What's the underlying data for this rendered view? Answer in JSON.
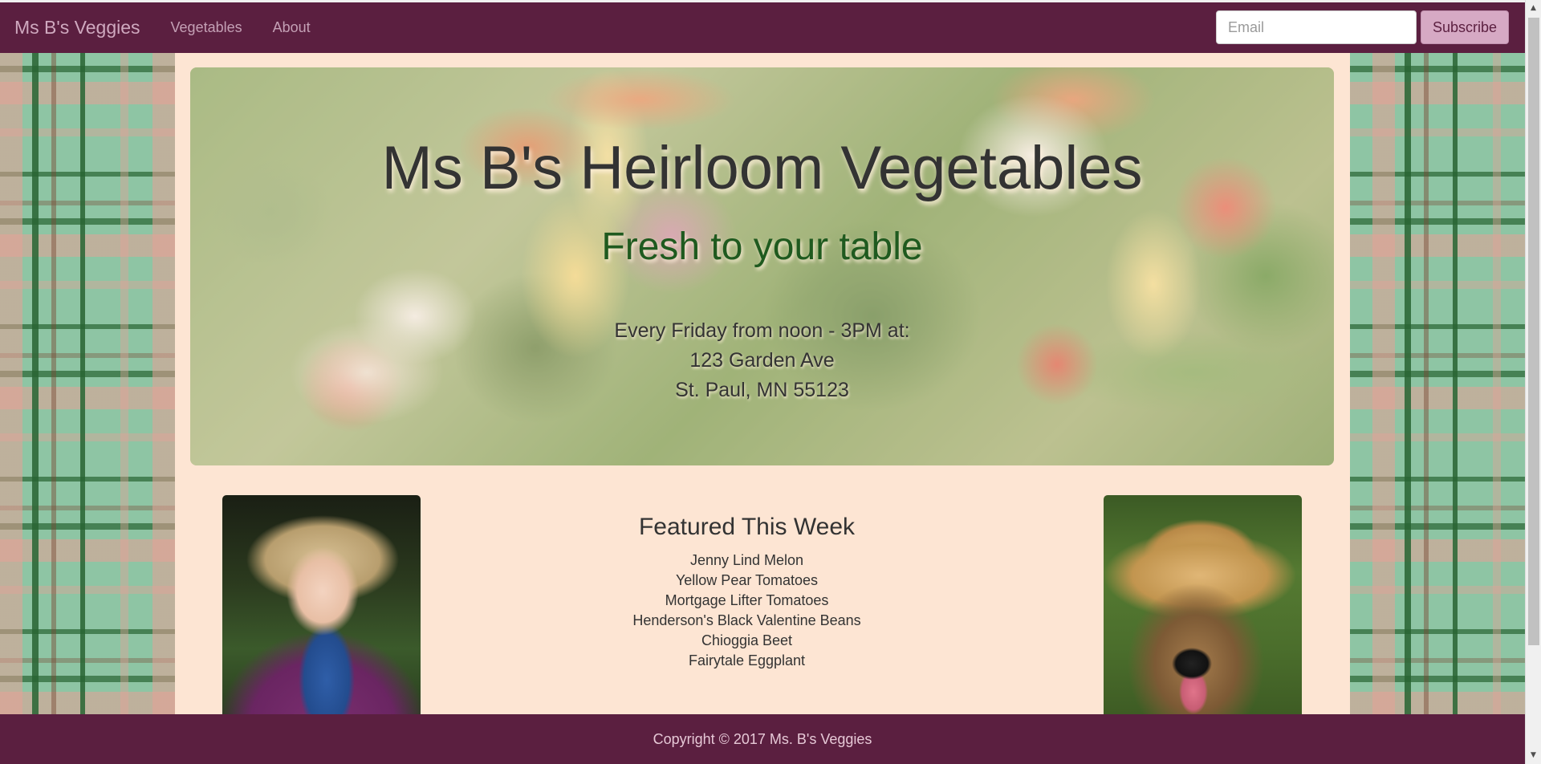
{
  "navbar": {
    "brand": "Ms B's Veggies",
    "links": [
      "Vegetables",
      "About"
    ],
    "email_placeholder": "Email",
    "subscribe_label": "Subscribe"
  },
  "hero": {
    "title": "Ms B's Heirloom Vegetables",
    "subtitle": "Fresh to your table",
    "schedule": "Every Friday from noon - 3PM at:",
    "address_line1": "123 Garden Ave",
    "address_line2": "St. Paul, MN 55123"
  },
  "featured": {
    "heading": "Featured This Week",
    "items": [
      "Jenny Lind Melon",
      "Yellow Pear Tomatoes",
      "Mortgage Lifter Tomatoes",
      "Henderson's Black Valentine Beans",
      "Chioggia Beet",
      "Fairytale Eggplant"
    ]
  },
  "footer": {
    "copyright": "Copyright © 2017 Ms. B's Veggies"
  },
  "colors": {
    "navbar_bg": "#5b1f40",
    "content_bg": "#fde5d3",
    "subtitle_green": "#1f5a1f",
    "subscribe_bg": "#d6a9c4"
  }
}
